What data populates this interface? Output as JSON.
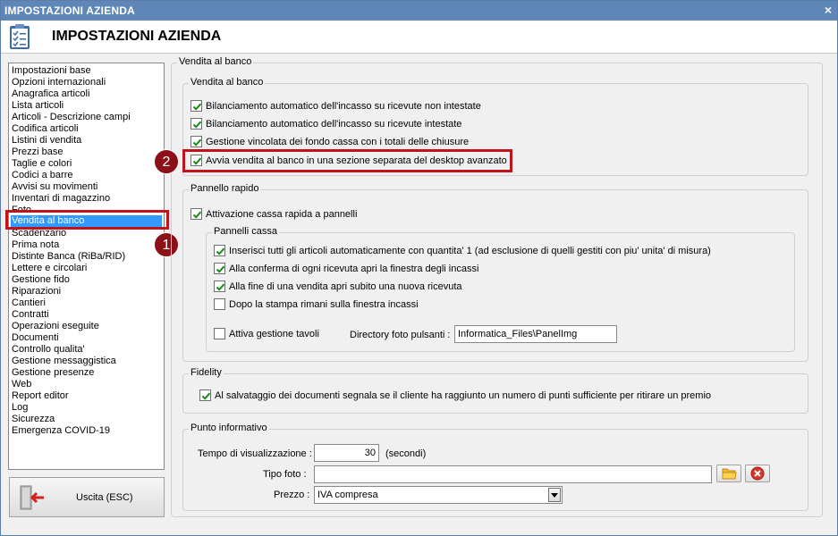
{
  "window": {
    "title": "IMPOSTAZIONI AZIENDA",
    "close_glyph": "×"
  },
  "header": {
    "title": "IMPOSTAZIONI AZIENDA",
    "icon": "clipboard-checklist-icon"
  },
  "sidebar": {
    "items": [
      "Impostazioni base",
      "Opzioni internazionali",
      "Anagrafica articoli",
      "Lista articoli",
      "Articoli - Descrizione campi",
      "Codifica articoli",
      "Listini di vendita",
      "Prezzi base",
      "Taglie e colori",
      "Codici a barre",
      "Avvisi su movimenti",
      "Inventari di magazzino",
      "Foto",
      "Vendita al banco",
      "Scadenzario",
      "Prima nota",
      "Distinte Banca (RiBa/RID)",
      "Lettere e circolari",
      "Gestione fido",
      "Riparazioni",
      "Cantieri",
      "Contratti",
      "Operazioni eseguite",
      "Documenti",
      "Controllo qualita'",
      "Gestione messaggistica",
      "Gestione presenze",
      "Web",
      "Report editor",
      "Log",
      "Sicurezza",
      "Emergenza COVID-19"
    ],
    "selected": "Vendita al banco"
  },
  "badges": {
    "one": "1",
    "two": "2"
  },
  "exit_button": {
    "label": "Uscita (ESC)",
    "icon": "exit-door-icon"
  },
  "main": {
    "outer_legend": "Vendita al banco",
    "vendita": {
      "legend": "Vendita al banco",
      "options": [
        {
          "label": "Bilanciamento automatico dell'incasso su ricevute non intestate",
          "checked": true
        },
        {
          "label": "Bilanciamento automatico dell'incasso su ricevute intestate",
          "checked": true
        },
        {
          "label": "Gestione vincolata dei fondo cassa con i totali delle chiusure",
          "checked": true
        },
        {
          "label": "Avvia vendita al banco in una sezione separata del desktop avanzato",
          "checked": true
        }
      ]
    },
    "pannello": {
      "legend": "Pannello rapido",
      "attivazione": {
        "label": "Attivazione cassa rapida a pannelli",
        "checked": true
      },
      "cassa": {
        "legend": "Pannelli cassa",
        "options": [
          {
            "label": "Inserisci tutti gli articoli automaticamente con quantita' 1 (ad esclusione di quelli gestiti con piu' unita' di misura)",
            "checked": true
          },
          {
            "label": "Alla conferma di ogni ricevuta apri la finestra degli incassi",
            "checked": true
          },
          {
            "label": "Alla fine di una vendita apri subito una nuova ricevuta",
            "checked": true
          },
          {
            "label": "Dopo la stampa rimani sulla finestra incassi",
            "checked": false
          }
        ],
        "tavoli": {
          "label": "Attiva gestione tavoli",
          "checked": false
        },
        "directory_label": "Directory foto pulsanti :",
        "directory_value": "Informatica_Files\\PanelImg"
      }
    },
    "fidelity": {
      "legend": "Fidelity",
      "option": {
        "label": "Al salvataggio dei documenti segnala se il cliente ha raggiunto un numero di punti sufficiente per ritirare un premio",
        "checked": true
      }
    },
    "punto": {
      "legend": "Punto informativo",
      "tempo_label": "Tempo di visualizzazione :",
      "tempo_value": "30",
      "tempo_unit": "(secondi)",
      "tipo_label": "Tipo foto :",
      "tipo_value": "",
      "prezzo_label": "Prezzo :",
      "prezzo_value": "IVA compresa"
    }
  },
  "colors": {
    "accent": "#3399ff",
    "highlight": "#c0141c",
    "titlebar": "#5e86b6",
    "badge": "#8c1018"
  }
}
